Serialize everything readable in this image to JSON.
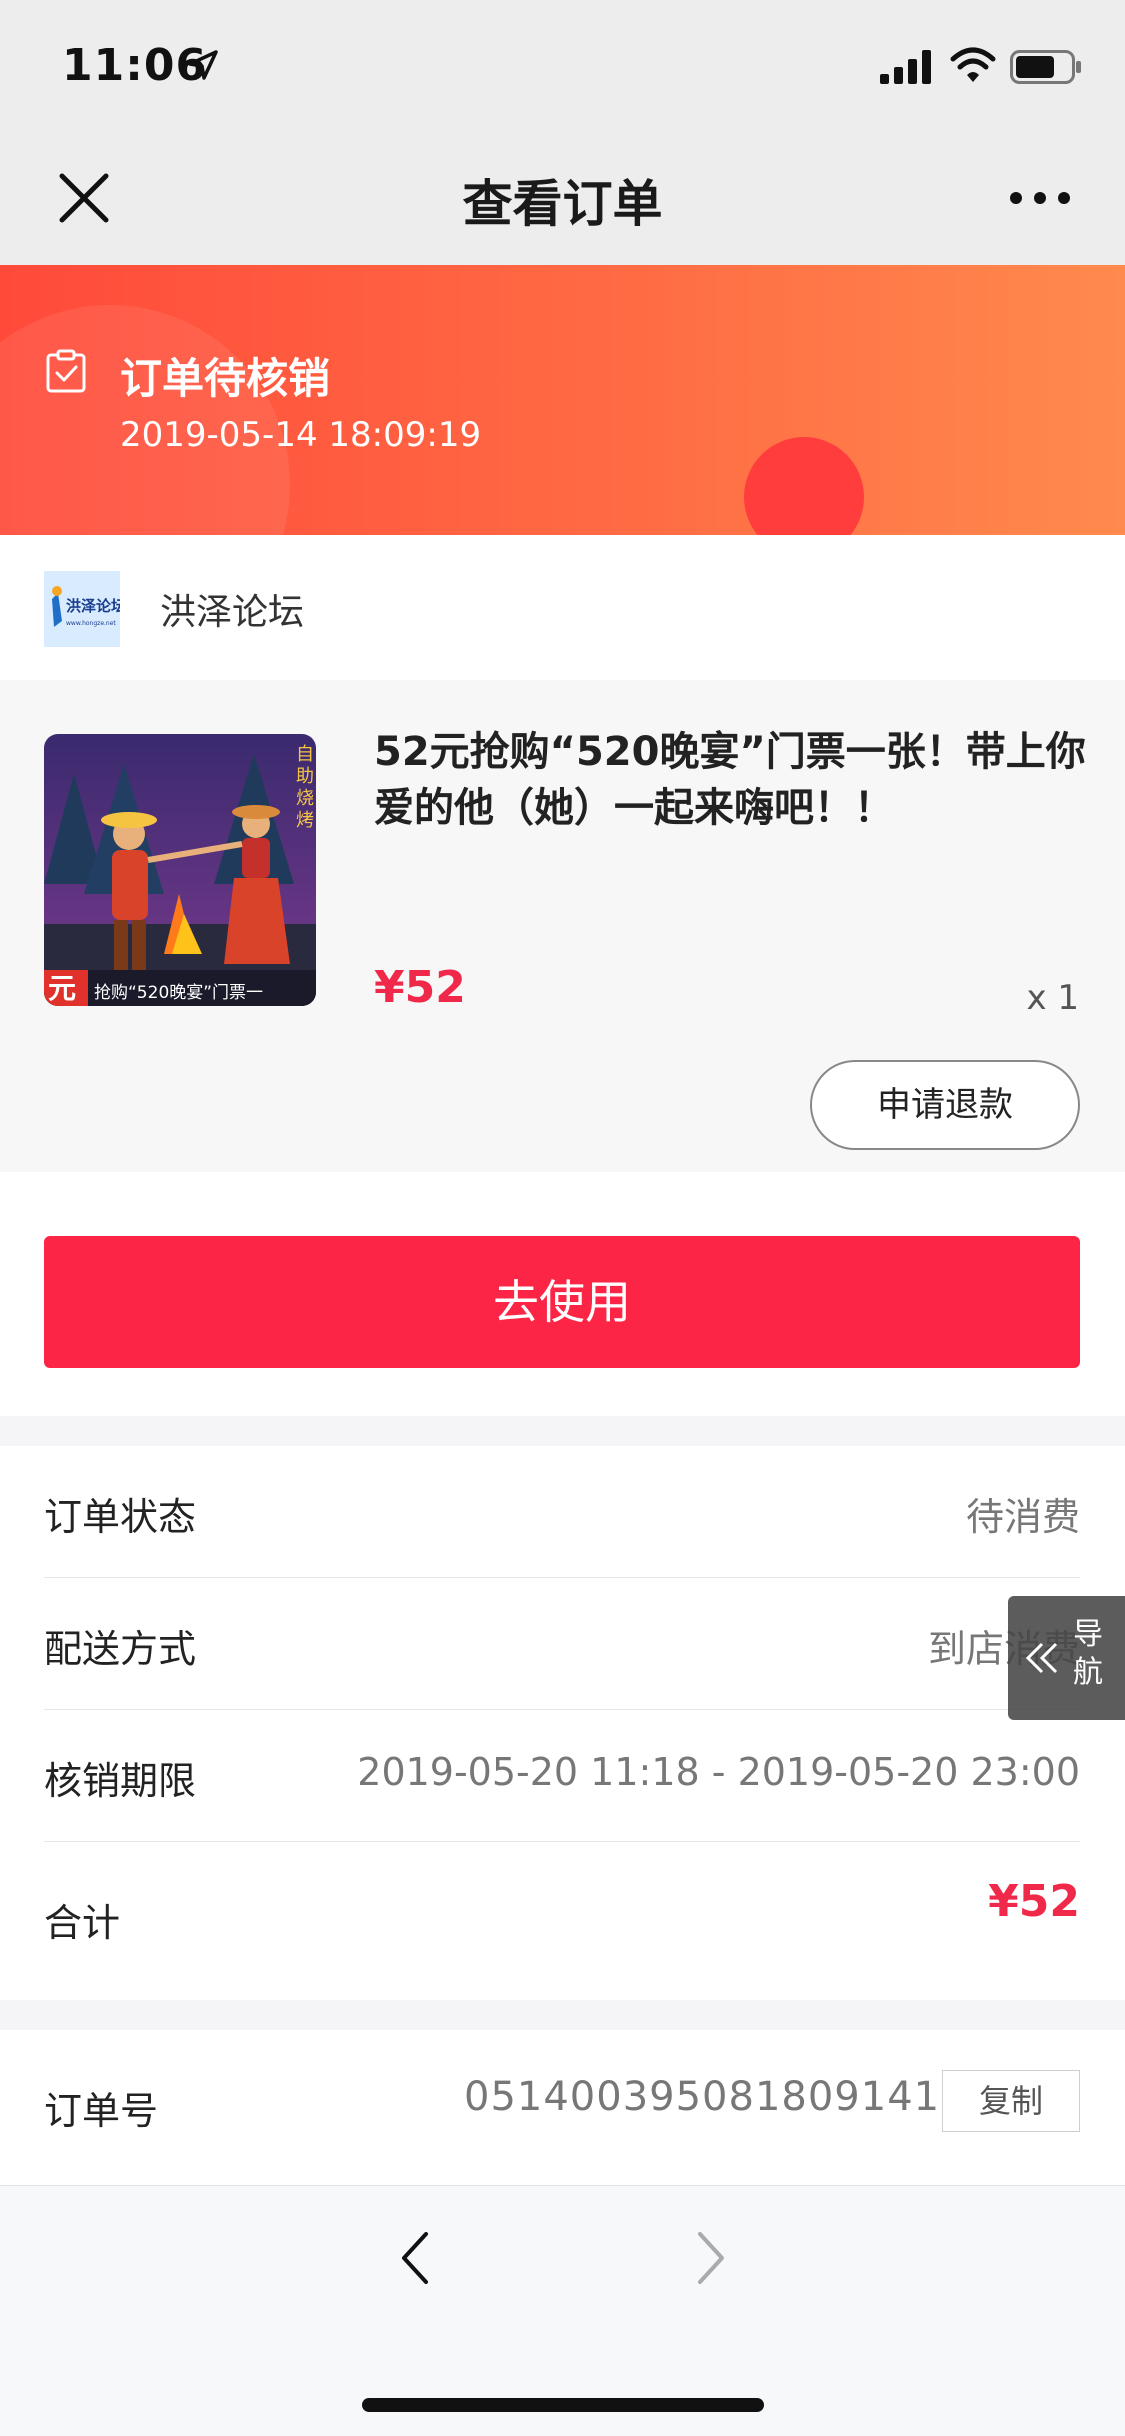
{
  "status_bar": {
    "time": "11:06"
  },
  "nav": {
    "title": "查看订单"
  },
  "banner": {
    "status": "订单待核销",
    "time": "2019-05-14 18:09:19"
  },
  "shop": {
    "name": "洪泽论坛",
    "logo_text": "洪泽论坛"
  },
  "product": {
    "title": "52元抢购“520晚宴”门票一张！带上你爱的他（她）一起来嗨吧！！",
    "price": "¥52",
    "quantity": "x 1",
    "refund_label": "申请退款",
    "thumb_text": "元 抢购“520晚宴”门票一"
  },
  "use_button": "去使用",
  "info": {
    "status_key": "订单状态",
    "status_val": "待消费",
    "delivery_key": "配送方式",
    "delivery_val": "到店消费",
    "period_key": "核销期限",
    "period_val": "2019-05-20 11:18 - 2019-05-20 23:00",
    "total_key": "合计",
    "total_val": "¥52"
  },
  "order": {
    "key": "订单号",
    "value": "051400395081809141",
    "copy_label": "复制"
  },
  "float_nav": {
    "label": "导航"
  },
  "colors": {
    "accent": "#fd2546",
    "banner": "#ff5a3e",
    "price": "#f0294a"
  }
}
